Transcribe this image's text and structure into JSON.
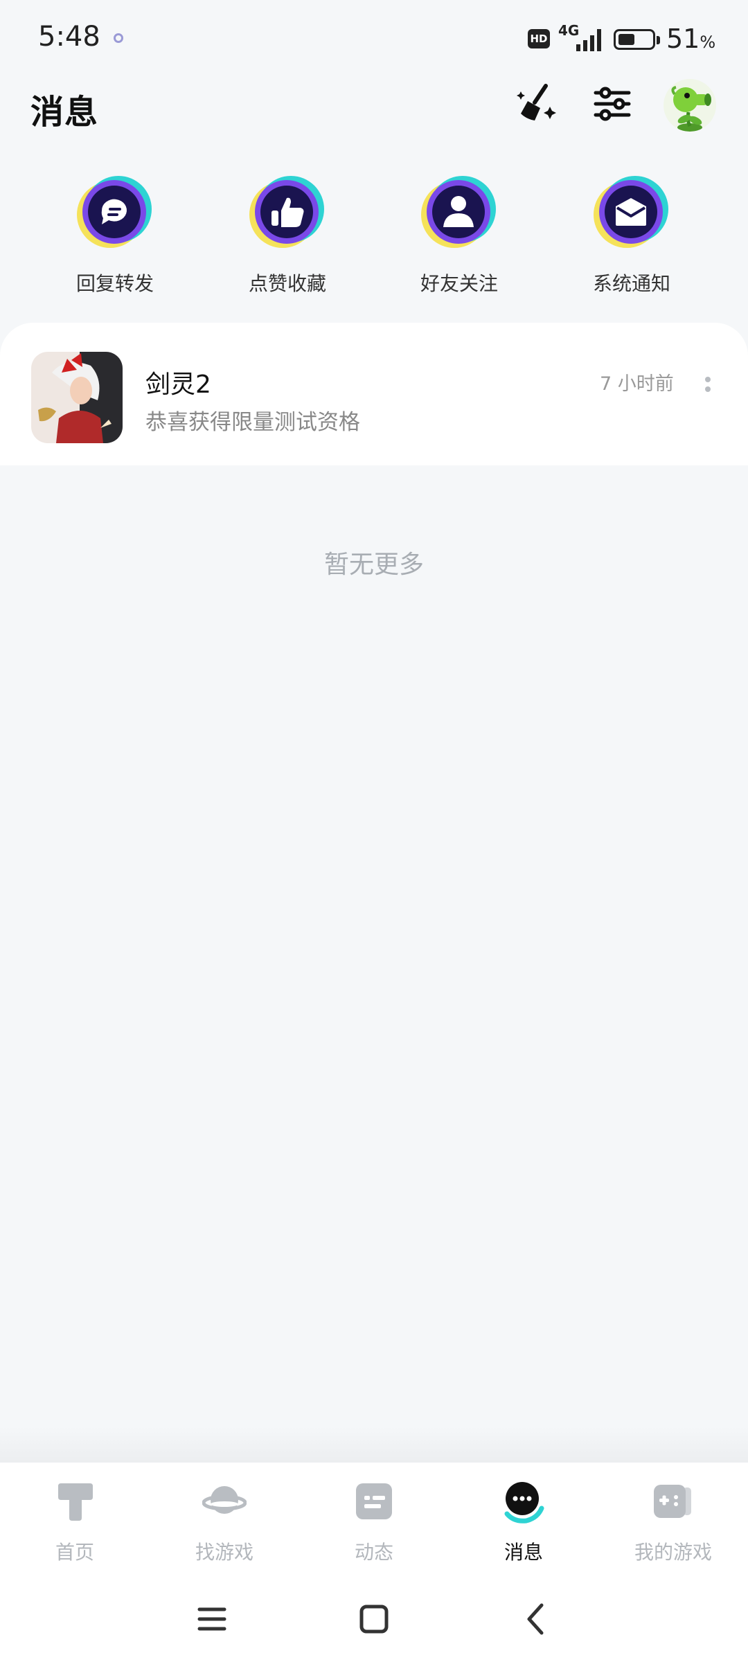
{
  "status_bar": {
    "time": "5:48",
    "hd": "HD",
    "network": "4G",
    "battery_percent": "51",
    "battery_unit": "%",
    "battery_level": 0.51
  },
  "header": {
    "title": "消息",
    "icons": [
      "clean-broom-icon",
      "settings-sliders-icon",
      "avatar"
    ]
  },
  "categories": [
    {
      "label": "回复转发",
      "icon": "chat-bubble-icon"
    },
    {
      "label": "点赞收藏",
      "icon": "thumbs-up-icon"
    },
    {
      "label": "好友关注",
      "icon": "person-icon"
    },
    {
      "label": "系统通知",
      "icon": "envelope-icon"
    }
  ],
  "messages": [
    {
      "title": "剑灵2",
      "subtitle": "恭喜获得限量测试资格",
      "time": "7 小时前"
    }
  ],
  "empty_text": "暂无更多",
  "bottom_nav": [
    {
      "label": "首页",
      "icon": "home-t-icon",
      "active": false
    },
    {
      "label": "找游戏",
      "icon": "planet-icon",
      "active": false
    },
    {
      "label": "动态",
      "icon": "feed-icon",
      "active": false
    },
    {
      "label": "消息",
      "icon": "message-bubble-icon",
      "active": true
    },
    {
      "label": "我的游戏",
      "icon": "gamepad-icon",
      "active": false
    }
  ],
  "system_nav": [
    "menu-icon",
    "home-square-icon",
    "back-icon"
  ],
  "colors": {
    "accent_teal": "#2ed3d3",
    "accent_yellow": "#f5e25a",
    "accent_purple": "#7a49e8",
    "icon_navy": "#1a1450",
    "background": "#f5f7f9"
  }
}
